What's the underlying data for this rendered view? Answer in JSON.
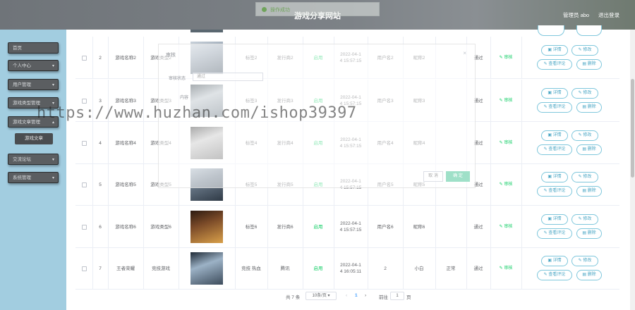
{
  "header": {
    "title": "游戏分享网站",
    "user": "管理员 abo",
    "logout": "退出登录"
  },
  "toast": {
    "text": "操作成功"
  },
  "sidebar": {
    "items": [
      {
        "label": "首页"
      },
      {
        "label": "个人中心"
      },
      {
        "label": "用户管理"
      },
      {
        "label": "游戏类型管理"
      },
      {
        "label": "游戏文章管理"
      },
      {
        "label": "交流论坛"
      },
      {
        "label": "系统管理"
      }
    ],
    "sub_item": "游戏文章"
  },
  "table": {
    "rows": [
      {
        "idx": "2",
        "name": "游戏名称2",
        "type": "游戏类型2",
        "tag": "标签2",
        "publisher": "发行商2",
        "status": "启用",
        "time": "2022-04-1\n4 15:57:15",
        "username": "用户名2",
        "nickname": "昵称2",
        "extra": "",
        "audit_result": "通过",
        "audit": "审核"
      },
      {
        "idx": "3",
        "name": "游戏名称3",
        "type": "游戏类型3",
        "tag": "标签3",
        "publisher": "发行商3",
        "status": "启用",
        "time": "2022-04-1\n4 15:57:15",
        "username": "用户名3",
        "nickname": "昵称3",
        "extra": "",
        "audit_result": "通过",
        "audit": "审核"
      },
      {
        "idx": "4",
        "name": "游戏名称4",
        "type": "游戏类型4",
        "tag": "标签4",
        "publisher": "发行商4",
        "status": "启用",
        "time": "2022-04-1\n4 15:57:15",
        "username": "用户名4",
        "nickname": "昵称4",
        "extra": "",
        "audit_result": "通过",
        "audit": "审核"
      },
      {
        "idx": "5",
        "name": "游戏名称5",
        "type": "游戏类型5",
        "tag": "标签5",
        "publisher": "发行商5",
        "status": "启用",
        "time": "2022-04-1\n4 15:57:15",
        "username": "用户名5",
        "nickname": "昵称5",
        "extra": "",
        "audit_result": "通过",
        "audit": "审核"
      },
      {
        "idx": "6",
        "name": "游戏名称6",
        "type": "游戏类型6",
        "tag": "标签6",
        "publisher": "发行商6",
        "status": "启用",
        "time": "2022-04-1\n4 15:57:15",
        "username": "用户名6",
        "nickname": "昵称6",
        "extra": "",
        "audit_result": "通过",
        "audit": "审核"
      },
      {
        "idx": "7",
        "name": "王者荣耀",
        "type": "竞技游戏",
        "tag": "竞技 热血",
        "publisher": "腾讯",
        "status": "启用",
        "time": "2022-04-1\n4 16:05:11",
        "username": "2",
        "nickname": "小白",
        "extra": "正常",
        "audit_result": "通过",
        "audit": "审核"
      }
    ],
    "actions": {
      "detail": "详情",
      "edit": "修改",
      "comments": "查看评论",
      "delete": "删除"
    }
  },
  "audit_dialog": {
    "title": "审核",
    "status_label": "审核状态",
    "status_placeholder": "通过",
    "content_label": "内容",
    "cancel": "取 消",
    "confirm": "确 定"
  },
  "watermark": "https://www.huzhan.com/ishop39397",
  "pagination": {
    "total": "共 7 条",
    "page_size": "10条/页",
    "current": "1",
    "goto_label": "前往",
    "goto_value": "1",
    "page_suffix": "页"
  },
  "colors": {
    "sidebar_bg": "#a2cde0",
    "header_bg": "#7d8287",
    "accent": "#4aa6c4",
    "status_green": "#13ce66"
  }
}
